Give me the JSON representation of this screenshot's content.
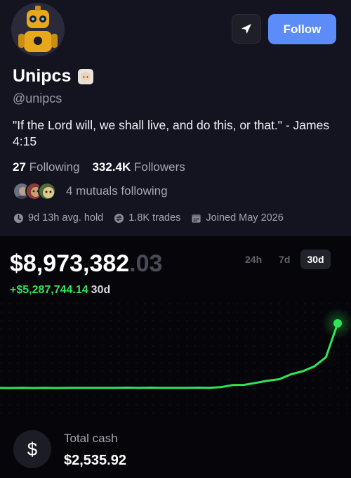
{
  "profile": {
    "display_name": "Unipcs",
    "handle": "@unipcs",
    "bio": "\"If the Lord will, we shall live, and do this, or that.\" - James 4:15",
    "avatar_icon": "robot-avatar",
    "name_badge_icon": "face-badge-icon",
    "follow_label": "Follow",
    "send_icon": "send-icon",
    "accent_color": "#5b8cf7"
  },
  "stats": {
    "following_count": "27",
    "following_label": "Following",
    "followers_count": "332.4K",
    "followers_label": "Followers"
  },
  "mutuals": {
    "text": "4 mutuals following",
    "avatar_count": 3
  },
  "meta": {
    "hold": "9d 13h avg. hold",
    "trades": "1.8K trades",
    "joined": "Joined May 2026"
  },
  "portfolio": {
    "balance_main": "$8,973,382",
    "balance_cents": ".03",
    "change_amount": "+$5,287,744.14",
    "change_period": "30d",
    "tabs": [
      "24h",
      "7d",
      "30d"
    ],
    "active_tab": "30d",
    "up_color": "#2ee55a"
  },
  "chart_data": {
    "type": "line",
    "period": "30d",
    "values": [
      3.69,
      3.68,
      3.69,
      3.68,
      3.69,
      3.68,
      3.7,
      3.69,
      3.7,
      3.69,
      3.7,
      3.71,
      3.7,
      3.71,
      3.7,
      3.69,
      3.7,
      3.71,
      3.7,
      3.75,
      3.92,
      3.94,
      4.1,
      4.28,
      4.4,
      4.8,
      5.05,
      5.45,
      6.2,
      8.97
    ],
    "grid": true
  },
  "cash": {
    "label": "Total cash",
    "value": "$2,535.92",
    "icon": "dollar-icon"
  }
}
